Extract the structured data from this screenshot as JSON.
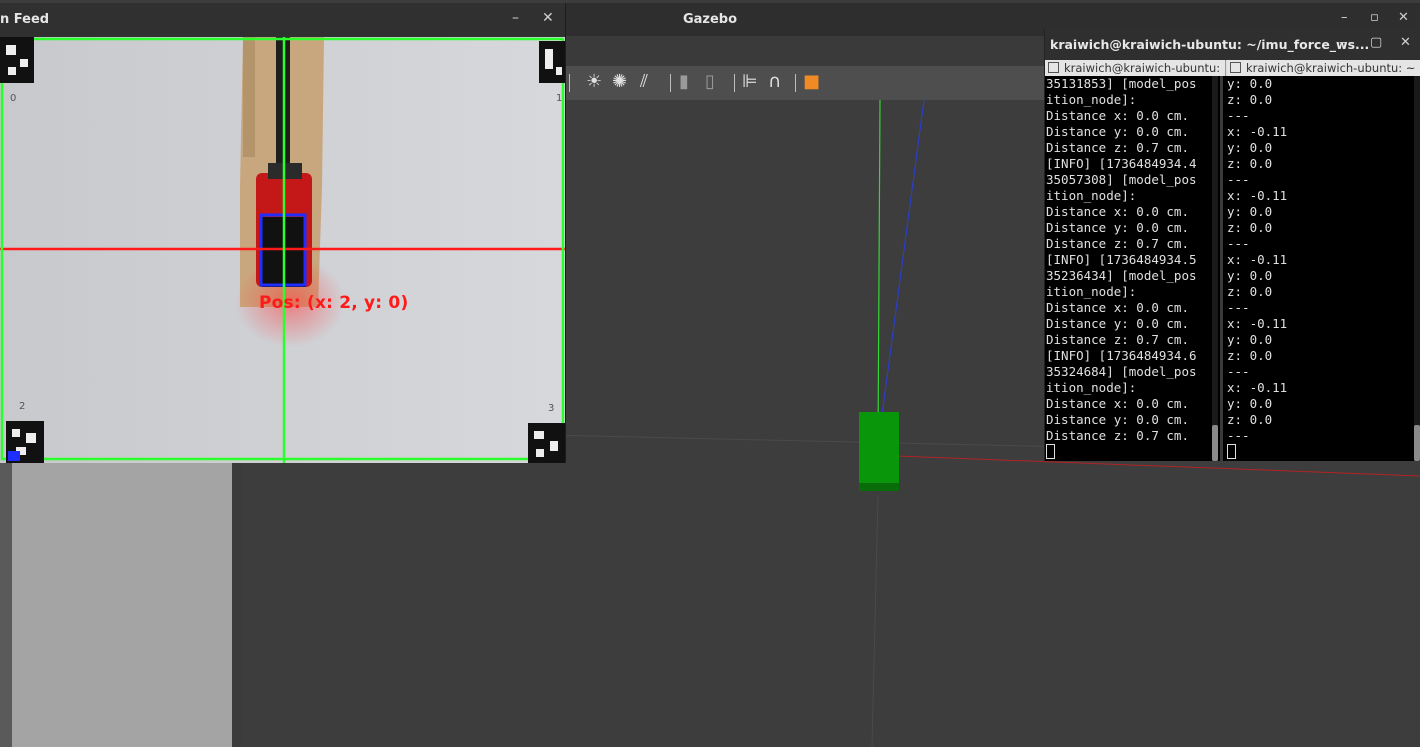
{
  "gazebo": {
    "title": "Gazebo",
    "controls": {
      "minimize": "–",
      "restore": "▫",
      "close": "✕"
    },
    "toolbar_icons": [
      "sun-light-icon",
      "spot-light-icon",
      "directional-light-icon",
      "copy-icon",
      "paste-icon",
      "align-icon",
      "snap-icon",
      "change-view-icon"
    ]
  },
  "camera_window": {
    "title": "n Feed",
    "minimize": "–",
    "close": "✕",
    "markers": [
      {
        "id": "0"
      },
      {
        "id": "1"
      },
      {
        "id": "2"
      },
      {
        "id": "3"
      }
    ],
    "position_label": "Pos: (x: 2, y: 0)"
  },
  "terminal": {
    "title": "kraiwich@kraiwich-ubuntu: ~/imu_force_ws...",
    "controls": {
      "minimize": "–",
      "maximize": "▢",
      "close": "✕"
    },
    "tabs": [
      "kraiwich@kraiwich-ubuntu: ~",
      "kraiwich@kraiwich-ubuntu: ~"
    ],
    "left_pane": "35131853] [model_pos\nition_node]:\nDistance x: 0.0 cm.\nDistance y: 0.0 cm.\nDistance z: 0.7 cm.\n[INFO] [1736484934.4\n35057308] [model_pos\nition_node]:\nDistance x: 0.0 cm.\nDistance y: 0.0 cm.\nDistance z: 0.7 cm.\n[INFO] [1736484934.5\n35236434] [model_pos\nition_node]:\nDistance x: 0.0 cm.\nDistance y: 0.0 cm.\nDistance z: 0.7 cm.\n[INFO] [1736484934.6\n35324684] [model_pos\nition_node]:\nDistance x: 0.0 cm.\nDistance y: 0.0 cm.\nDistance z: 0.7 cm.",
    "right_pane": "y: 0.0\nz: 0.0\n---\nx: -0.11\ny: 0.0\nz: 0.0\n---\nx: -0.11\ny: 0.0\nz: 0.0\n---\nx: -0.11\ny: 0.0\nz: 0.0\n---\nx: -0.11\ny: 0.0\nz: 0.0\n---\nx: -0.11\ny: 0.0\nz: 0.0\n---"
  }
}
